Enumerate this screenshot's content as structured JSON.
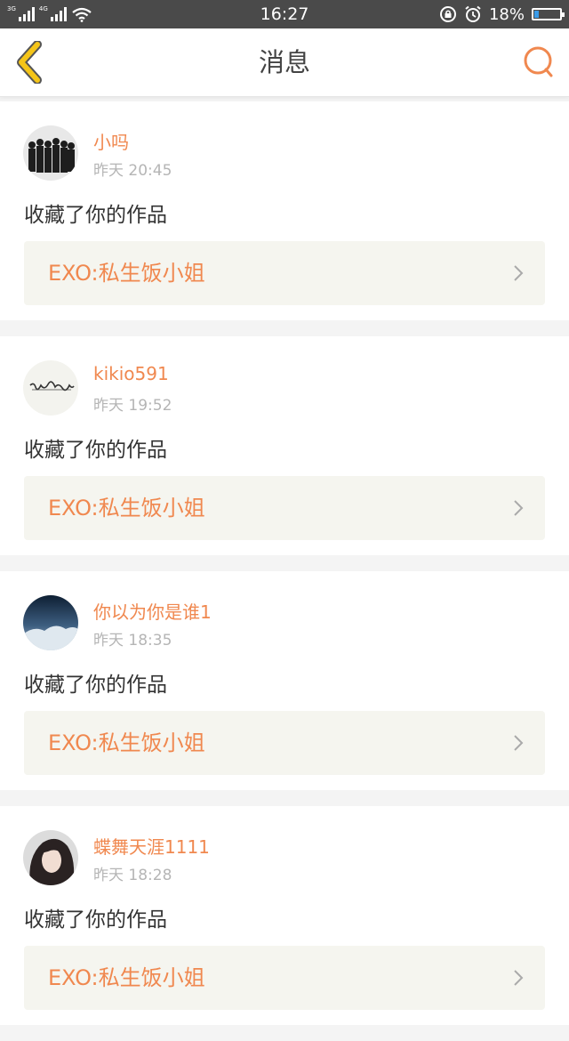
{
  "status_bar": {
    "network_1": "3G",
    "network_2": "4G",
    "time": "16:27",
    "battery": "18%",
    "battery_level": 0.18
  },
  "header": {
    "title": "消息"
  },
  "messages": [
    {
      "username": "小吗",
      "time": "昨天 20:45",
      "action": "收藏了你的作品",
      "work_title": "EXO:私生饭小姐"
    },
    {
      "username": "kikio591",
      "time": "昨天 19:52",
      "action": "收藏了你的作品",
      "work_title": "EXO:私生饭小姐"
    },
    {
      "username": "你以为你是谁1",
      "time": "昨天 18:35",
      "action": "收藏了你的作品",
      "work_title": "EXO:私生饭小姐"
    },
    {
      "username": "蝶舞天涯1111",
      "time": "昨天 18:28",
      "action": "收藏了你的作品",
      "work_title": "EXO:私生饭小姐"
    }
  ],
  "colors": {
    "accent": "#f0884f",
    "back_icon": "#f5c518",
    "status_bar": "#4a4a4a"
  }
}
